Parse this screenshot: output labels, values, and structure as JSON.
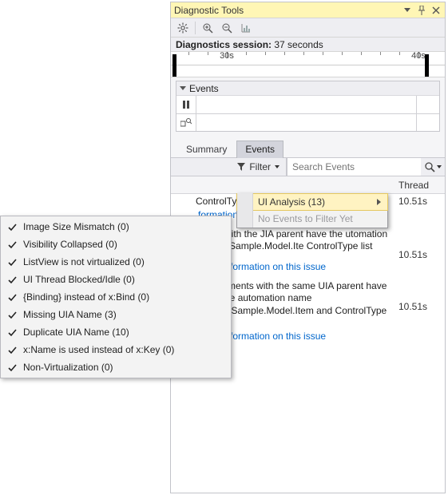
{
  "window": {
    "title": "Diagnostic Tools",
    "session_prefix": "Diagnostics session: ",
    "session_value": "37 seconds"
  },
  "timeline": {
    "ticks": [
      "30s",
      "40s"
    ],
    "events_label": "Events"
  },
  "tabs": {
    "summary": "Summary",
    "events": "Events"
  },
  "filter": {
    "button_label": "Filter",
    "search_placeholder": "Search Events"
  },
  "dropdown": {
    "ui_analysis": "UI Analysis (13)",
    "no_events": "No Events to Filter Yet"
  },
  "grid": {
    "col_thread": "Thread"
  },
  "events_list": [
    {
      "text_tail": "ControlType list",
      "link_pre": "formation on this",
      "time": "10.51s"
    },
    {
      "text": "ments with the JIA parent have the utomation name wSample.Model.Ite ControlType list",
      "link": "More information on this issue",
      "time": "10.51s"
    },
    {
      "text": "UIA Elements with the same UIA parent have the same automation name ListViewSample.Model.Item and ControlType list item.",
      "link": "More information on this issue",
      "time": "10.51s"
    }
  ],
  "checklist": [
    "Image Size Mismatch (0)",
    "Visibility Collapsed (0)",
    "ListView is not virtualized (0)",
    "UI Thread Blocked/Idle (0)",
    "{Binding} instead of x:Bind (0)",
    "Missing UIA Name (3)",
    "Duplicate UIA Name (10)",
    "x:Name is used instead of x:Key (0)",
    "Non-Virtualization (0)"
  ]
}
